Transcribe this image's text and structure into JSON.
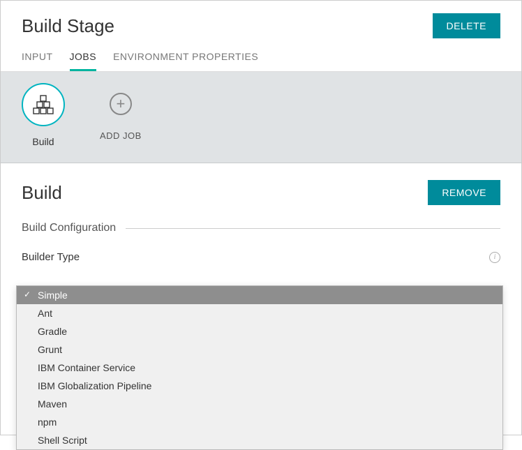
{
  "header": {
    "title": "Build Stage",
    "delete_label": "DELETE"
  },
  "tabs": {
    "input": "INPUT",
    "jobs": "JOBS",
    "env": "ENVIRONMENT PROPERTIES",
    "active": "jobs"
  },
  "jobs_strip": {
    "build_job_label": "Build",
    "add_job_label": "ADD JOB"
  },
  "section": {
    "title": "Build",
    "remove_label": "REMOVE",
    "config_heading": "Build Configuration",
    "builder_type_label": "Builder Type"
  },
  "builder_type": {
    "selected": "Simple",
    "options": [
      "Simple",
      "Ant",
      "Gradle",
      "Grunt",
      "IBM Container Service",
      "IBM Globalization Pipeline",
      "Maven",
      "npm",
      "Shell Script"
    ]
  },
  "colors": {
    "accent": "#008b9b",
    "accent_light": "#00b4a0"
  }
}
